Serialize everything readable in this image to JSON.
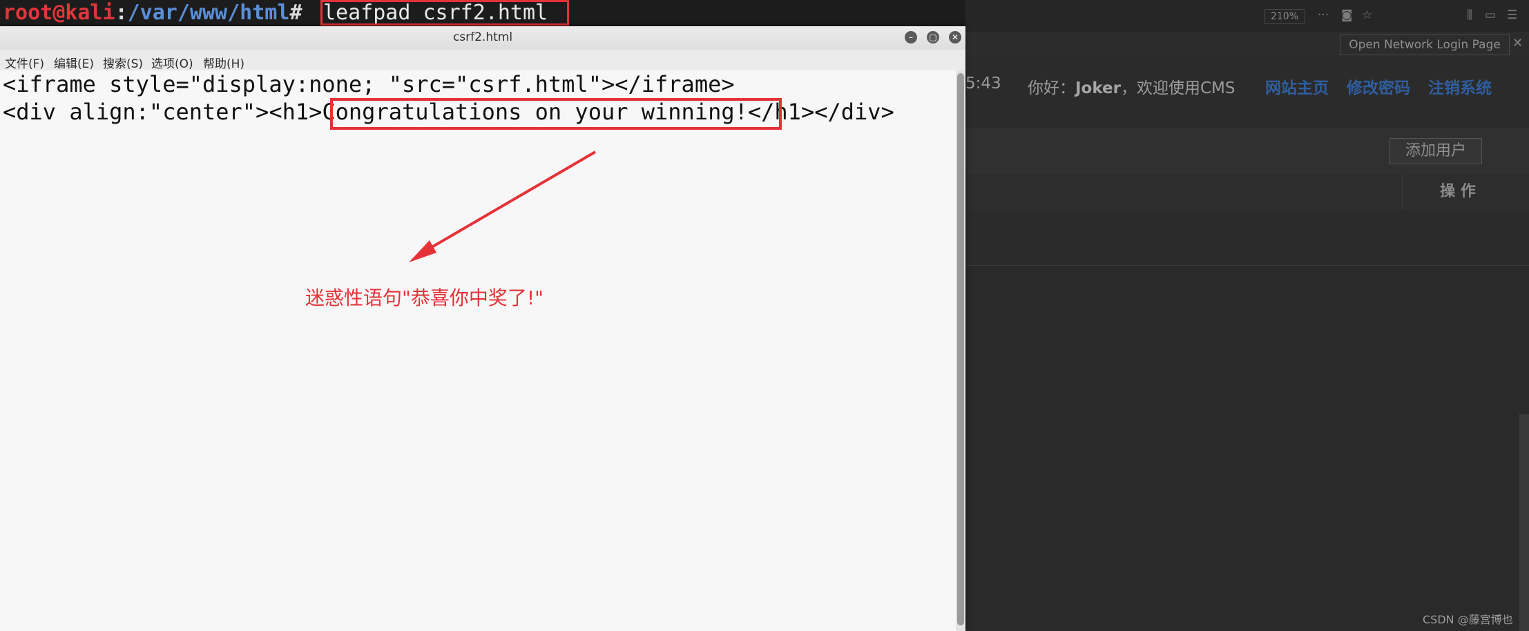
{
  "terminal": {
    "user_host": "root@kali",
    "colon": ":",
    "path": "/var/www/html",
    "hash": "#",
    "command": "leafpad csrf2.html"
  },
  "leafpad": {
    "title": "csrf2.html",
    "menu": [
      "文件(F)",
      "编辑(E)",
      "搜索(S)",
      "选项(O)",
      "帮助(H)"
    ],
    "line1": "<iframe style=\"display:none; \"src=\"csrf.html\"></iframe>",
    "line2_prefix": "<div align:\"center\"><h1>",
    "line2_highlight": "Congratulations on your winning!",
    "line2_suffix": "</h1></div>"
  },
  "annotation": {
    "note": "迷惑性语句\"恭喜你中奖了!\"",
    "accent_color": "#e53238"
  },
  "browser": {
    "zoom": "210%",
    "tab": "Open Network Login Page",
    "clock": "5:43",
    "greeting_prefix": "你好：",
    "user": "Joker",
    "greeting_suffix": "，欢迎使用CMS",
    "nav": [
      "网站主页",
      "修改密码",
      "注销系统"
    ],
    "add_user": "添加用户",
    "column_op": "操 作",
    "link_color": "#2f5e9e"
  },
  "watermark": "CSDN @藤宫博也"
}
